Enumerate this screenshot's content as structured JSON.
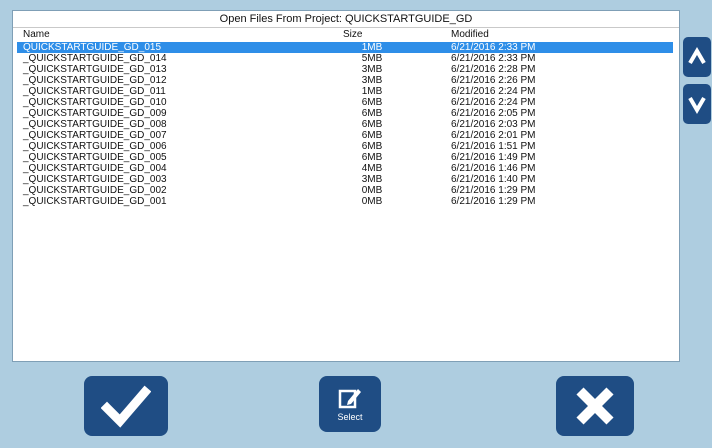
{
  "window": {
    "title": "Open Files From Project: QUICKSTARTGUIDE_GD"
  },
  "table": {
    "headers": {
      "name": "Name",
      "size": "Size",
      "modified": "Modified"
    },
    "rows": [
      {
        "name": "QUICKSTARTGUIDE_GD_015",
        "size": "1MB",
        "modified": "6/21/2016  2:33 PM",
        "selected": true
      },
      {
        "name": "_QUICKSTARTGUIDE_GD_014",
        "size": "5MB",
        "modified": "6/21/2016  2:33 PM"
      },
      {
        "name": "_QUICKSTARTGUIDE_GD_013",
        "size": "3MB",
        "modified": "6/21/2016  2:28 PM"
      },
      {
        "name": "_QUICKSTARTGUIDE_GD_012",
        "size": "3MB",
        "modified": "6/21/2016  2:26 PM"
      },
      {
        "name": "_QUICKSTARTGUIDE_GD_011",
        "size": "1MB",
        "modified": "6/21/2016  2:24 PM"
      },
      {
        "name": "_QUICKSTARTGUIDE_GD_010",
        "size": "6MB",
        "modified": "6/21/2016  2:24 PM"
      },
      {
        "name": "_QUICKSTARTGUIDE_GD_009",
        "size": "6MB",
        "modified": "6/21/2016  2:05 PM"
      },
      {
        "name": "_QUICKSTARTGUIDE_GD_008",
        "size": "6MB",
        "modified": "6/21/2016  2:03 PM"
      },
      {
        "name": "_QUICKSTARTGUIDE_GD_007",
        "size": "6MB",
        "modified": "6/21/2016  2:01 PM"
      },
      {
        "name": "_QUICKSTARTGUIDE_GD_006",
        "size": "6MB",
        "modified": "6/21/2016  1:51 PM"
      },
      {
        "name": "_QUICKSTARTGUIDE_GD_005",
        "size": "6MB",
        "modified": "6/21/2016  1:49 PM"
      },
      {
        "name": "_QUICKSTARTGUIDE_GD_004",
        "size": "4MB",
        "modified": "6/21/2016  1:46 PM"
      },
      {
        "name": "_QUICKSTARTGUIDE_GD_003",
        "size": "3MB",
        "modified": "6/21/2016  1:40 PM"
      },
      {
        "name": "_QUICKSTARTGUIDE_GD_002",
        "size": "0MB",
        "modified": "6/21/2016  1:29 PM"
      },
      {
        "name": "_QUICKSTARTGUIDE_GD_001",
        "size": "0MB",
        "modified": "6/21/2016  1:29 PM"
      }
    ]
  },
  "buttons": {
    "select_label": "Select",
    "ok_icon": "checkmark-icon",
    "select_icon": "edit-icon",
    "cancel_icon": "x-icon",
    "scroll_up_icon": "chevron-up-icon",
    "scroll_down_icon": "chevron-down-icon"
  },
  "colors": {
    "background": "#aecde0",
    "button": "#1f4d84",
    "selection": "#2e8ee8"
  }
}
